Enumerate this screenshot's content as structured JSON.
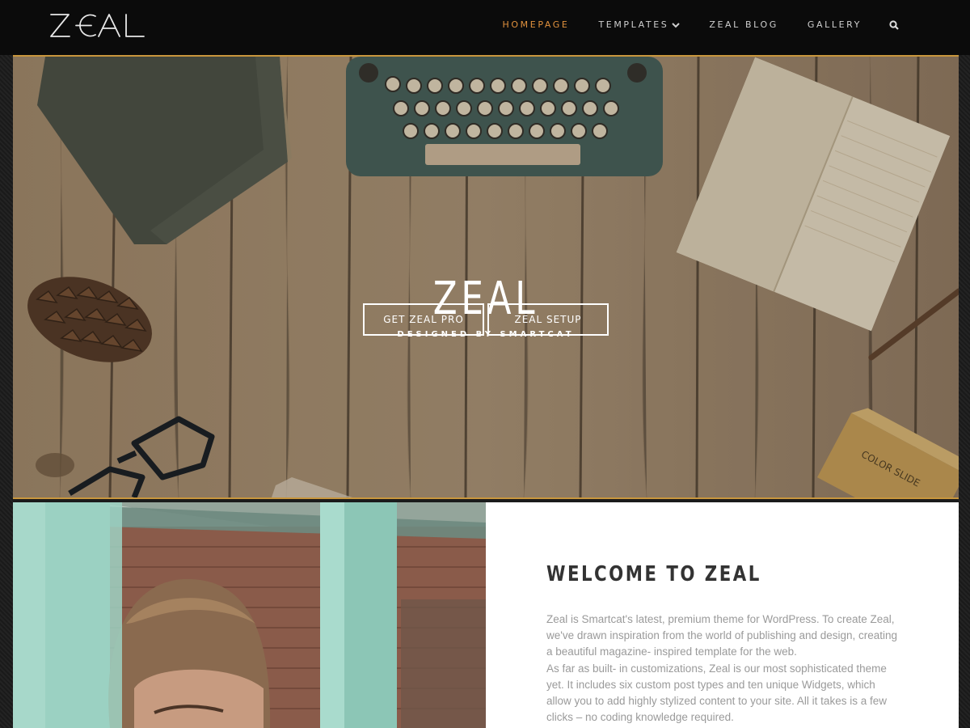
{
  "brand": {
    "logo_text": "ZEAL"
  },
  "nav": {
    "items": [
      {
        "label": "HOMEPAGE",
        "active": true
      },
      {
        "label": "TEMPLATES",
        "dropdown": true
      },
      {
        "label": "ZEAL BLOG"
      },
      {
        "label": "GALLERY"
      }
    ],
    "search_icon": "search-icon"
  },
  "hero": {
    "title": "ZEAL",
    "subtitle": "DESIGNED BY SMARTCAT",
    "buttons": [
      "GET ZEAL PRO",
      "ZEAL SETUP"
    ],
    "desk_props": {
      "keys_row1": "QWERTYUIOP",
      "keys_row2": "ASDFGHJKL",
      "keys_row3": "ZXCVBNM",
      "box_label": "COLOR SLIDE"
    }
  },
  "welcome": {
    "title": "WELCOME TO ZEAL",
    "paragraph1": "Zeal is Smartcat's latest, premium theme for WordPress. To create Zeal, we've drawn inspiration from the world of publishing and design, creating a beautiful magazine- inspired template for the web.",
    "paragraph2": "As far as built- in customizations, Zeal is our most sophisticated theme yet. It includes six custom post types and ten unique Widgets, which allow you to add highly stylized content to your site. All it takes is a few clicks – no coding knowledge required."
  },
  "colors": {
    "accent": "#e0913d",
    "gold_line": "#c8963d",
    "nav_bg": "#0b0b0b"
  }
}
